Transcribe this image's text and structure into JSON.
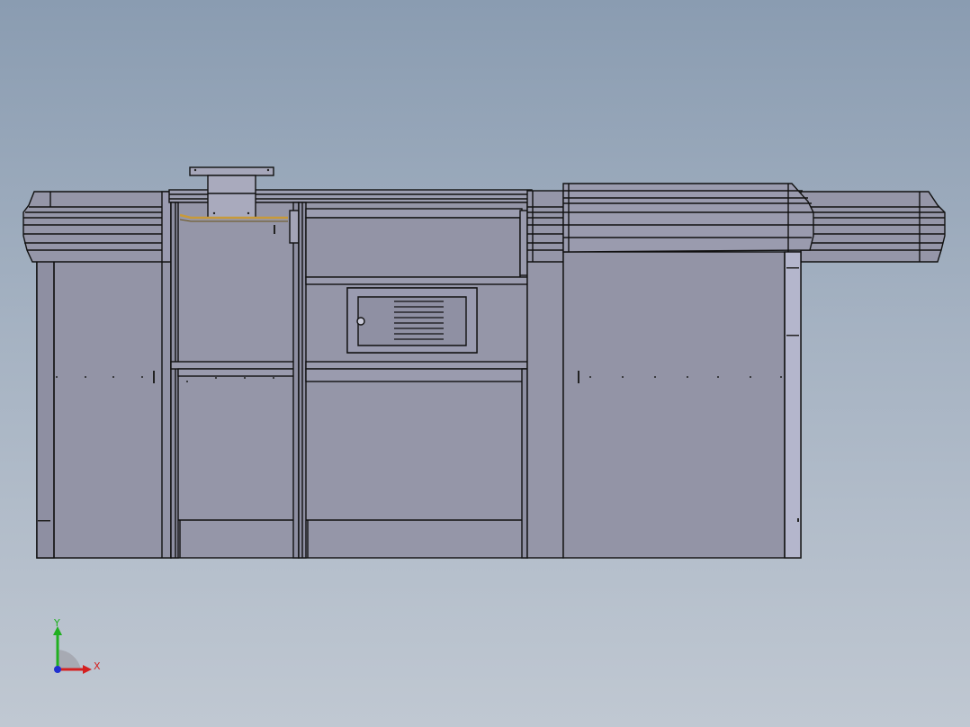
{
  "viewport": {
    "background_top": "#8a9cb1",
    "background_bottom": "#c0c8d2"
  },
  "model": {
    "body_color": "#9596a8",
    "body_dark": "#8a8b9c",
    "trim_color": "#b4b6cc",
    "edge_color": "#111111",
    "accent_cable_color": "#c89a3a"
  },
  "triad": {
    "x_label": "X",
    "y_label": "Y",
    "x_color": "#d42020",
    "y_color": "#20b020",
    "z_color": "#2030d0"
  }
}
